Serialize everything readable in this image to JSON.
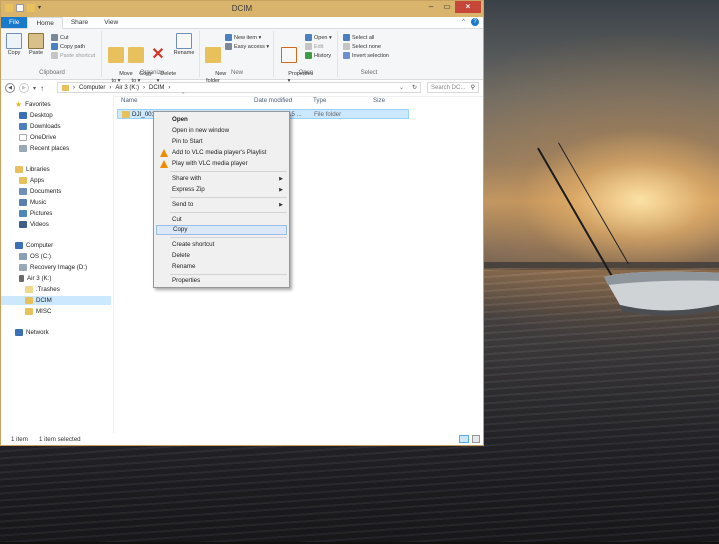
{
  "window": {
    "title": "DCIM",
    "close_glyph": "×",
    "minimize_glyph": "–",
    "maximize_glyph": "▭"
  },
  "ribbon_tabs": [
    "File",
    "Home",
    "Share",
    "View"
  ],
  "ribbon": {
    "clipboard": {
      "label": "Clipboard",
      "copy": "Copy",
      "paste": "Paste",
      "cut": "Cut",
      "copy_path": "Copy path",
      "paste_shortcut": "Paste shortcut"
    },
    "organize": {
      "label": "Organize",
      "move_to": "Move\nto ▾",
      "copy_to": "Copy\nto ▾",
      "delete": "Delete\n▾",
      "rename": "Rename"
    },
    "new": {
      "label": "New",
      "new_folder": "New\nfolder",
      "new_item": "New item ▾",
      "easy_access": "Easy access ▾"
    },
    "open": {
      "label": "Open",
      "properties": "Properties\n▾",
      "open": "Open ▾",
      "edit": "Edit",
      "history": "History"
    },
    "select": {
      "label": "Select",
      "select_all": "Select all",
      "select_none": "Select none",
      "invert_selection": "Invert selection"
    }
  },
  "address": {
    "path": [
      "Computer",
      "Air 3 (K:)",
      "DCIM"
    ],
    "separator": "›",
    "search_placeholder": "Search DC..."
  },
  "nav_pane": {
    "favorites": {
      "header": "Favorites",
      "items": [
        "Desktop",
        "Downloads",
        "OneDrive",
        "Recent places"
      ]
    },
    "libraries": {
      "header": "Libraries",
      "items": [
        "Apps",
        "Documents",
        "Music",
        "Pictures",
        "Videos"
      ]
    },
    "computer": {
      "header": "Computer",
      "items": [
        "OS (C:)",
        "Recovery Image (D:)",
        "Air 3 (K:)",
        ".Trashes",
        "DCIM",
        "MISC"
      ]
    },
    "network": {
      "header": "Network"
    }
  },
  "columns": [
    "Name",
    "Date modified",
    "Type",
    "Size"
  ],
  "files": [
    {
      "name": "DJI_001",
      "date": "15 ...",
      "type": "File folder"
    }
  ],
  "context_menu": {
    "items": [
      "Open",
      "Open in new window",
      "Pin to Start",
      "Add to VLC media player's Playlist",
      "Play with VLC media player",
      "Share with",
      "Express Zip",
      "Send to",
      "Cut",
      "Copy",
      "Create shortcut",
      "Delete",
      "Rename",
      "Properties"
    ],
    "highlighted": "Copy"
  },
  "status": {
    "item_count": "1 item",
    "selection": "1 item selected"
  },
  "colors": {
    "titlebar": "#d8b46d",
    "file_tab": "#1979ca",
    "selection": "#cce8ff",
    "close_button": "#c7463a"
  }
}
